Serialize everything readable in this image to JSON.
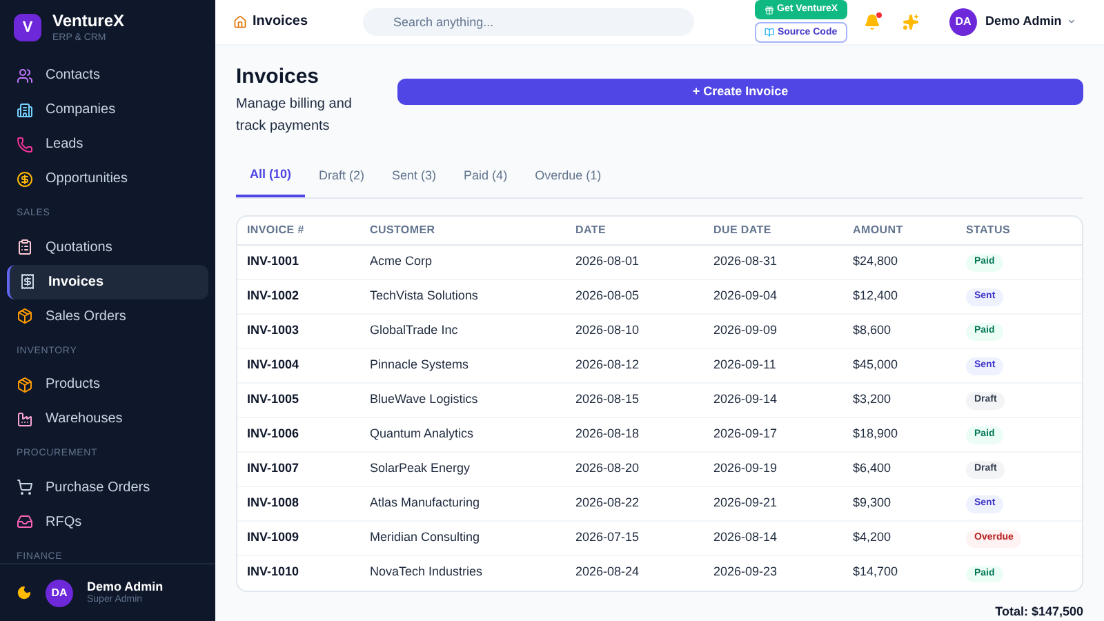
{
  "brand": {
    "logo": "V",
    "name": "VentureX",
    "tagline": "ERP & CRM"
  },
  "sidebar": {
    "sections": [
      {
        "items": [
          {
            "label": "Contacts",
            "selected": false
          },
          {
            "label": "Companies",
            "selected": false
          },
          {
            "label": "Leads",
            "selected": false
          },
          {
            "label": "Opportunities",
            "selected": false
          }
        ]
      },
      {
        "heading": "SALES",
        "items": [
          {
            "label": "Quotations",
            "selected": false
          },
          {
            "label": "Invoices",
            "selected": true
          },
          {
            "label": "Sales Orders",
            "selected": false
          }
        ]
      },
      {
        "heading": "INVENTORY",
        "items": [
          {
            "label": "Products",
            "selected": false
          },
          {
            "label": "Warehouses",
            "selected": false
          }
        ]
      },
      {
        "heading": "PROCUREMENT",
        "items": [
          {
            "label": "Purchase Orders",
            "selected": false
          },
          {
            "label": "RFQs",
            "selected": false
          }
        ]
      },
      {
        "heading": "FINANCE"
      }
    ]
  },
  "sidebar_footer": {
    "avatar": "DA",
    "name": "Demo Admin",
    "role": "Super Admin"
  },
  "topbar": {
    "breadcrumb": "Invoices",
    "search": {
      "placeholder": "Search anything..."
    },
    "get_button": "Get VentureX",
    "source_button": "Source Code",
    "notifications_unread": true,
    "user": {
      "avatar": "DA",
      "name": "Demo Admin"
    }
  },
  "page": {
    "title": "Invoices",
    "subtitle": "Manage billing and track payments",
    "create_button": "+ Create Invoice"
  },
  "tabs": [
    {
      "label": "All (10)",
      "selected": true
    },
    {
      "label": "Draft (2)",
      "selected": false
    },
    {
      "label": "Sent (3)",
      "selected": false
    },
    {
      "label": "Paid (4)",
      "selected": false
    },
    {
      "label": "Overdue (1)",
      "selected": false
    }
  ],
  "table": {
    "columns": [
      "INVOICE #",
      "CUSTOMER",
      "DATE",
      "DUE DATE",
      "AMOUNT",
      "STATUS"
    ],
    "rows": [
      {
        "invoice": "INV-1001",
        "customer": "Acme Corp",
        "date": "2026-08-01",
        "due": "2026-08-31",
        "amount": "$24,800",
        "status": "Paid",
        "kind": "paid"
      },
      {
        "invoice": "INV-1002",
        "customer": "TechVista Solutions",
        "date": "2026-08-05",
        "due": "2026-09-04",
        "amount": "$12,400",
        "status": "Sent",
        "kind": "sent"
      },
      {
        "invoice": "INV-1003",
        "customer": "GlobalTrade Inc",
        "date": "2026-08-10",
        "due": "2026-09-09",
        "amount": "$8,600",
        "status": "Paid",
        "kind": "paid"
      },
      {
        "invoice": "INV-1004",
        "customer": "Pinnacle Systems",
        "date": "2026-08-12",
        "due": "2026-09-11",
        "amount": "$45,000",
        "status": "Sent",
        "kind": "sent"
      },
      {
        "invoice": "INV-1005",
        "customer": "BlueWave Logistics",
        "date": "2026-08-15",
        "due": "2026-09-14",
        "amount": "$3,200",
        "status": "Draft",
        "kind": "draft"
      },
      {
        "invoice": "INV-1006",
        "customer": "Quantum Analytics",
        "date": "2026-08-18",
        "due": "2026-09-17",
        "amount": "$18,900",
        "status": "Paid",
        "kind": "paid"
      },
      {
        "invoice": "INV-1007",
        "customer": "SolarPeak Energy",
        "date": "2026-08-20",
        "due": "2026-09-19",
        "amount": "$6,400",
        "status": "Draft",
        "kind": "draft"
      },
      {
        "invoice": "INV-1008",
        "customer": "Atlas Manufacturing",
        "date": "2026-08-22",
        "due": "2026-09-21",
        "amount": "$9,300",
        "status": "Sent",
        "kind": "sent"
      },
      {
        "invoice": "INV-1009",
        "customer": "Meridian Consulting",
        "date": "2026-07-15",
        "due": "2026-08-14",
        "amount": "$4,200",
        "status": "Overdue",
        "kind": "overdue"
      },
      {
        "invoice": "INV-1010",
        "customer": "NovaTech Industries",
        "date": "2026-08-24",
        "due": "2026-09-23",
        "amount": "$14,700",
        "status": "Paid",
        "kind": "paid"
      }
    ]
  },
  "total": "Total: $147,500"
}
